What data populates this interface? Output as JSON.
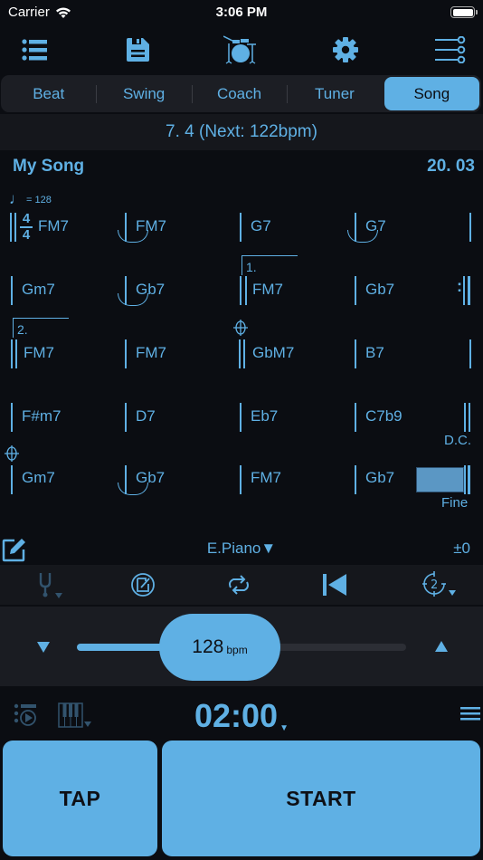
{
  "status_bar": {
    "carrier": "Carrier",
    "time": "3:06 PM",
    "wifi_icon": "wifi-icon",
    "battery_icon": "battery-icon"
  },
  "toolbar": {
    "icons": [
      "list-icon",
      "save-icon",
      "drum-kit-icon",
      "gear-icon",
      "mixer-sliders-icon"
    ]
  },
  "tabs": [
    {
      "label": "Beat",
      "active": false
    },
    {
      "label": "Swing",
      "active": false
    },
    {
      "label": "Coach",
      "active": false
    },
    {
      "label": "Tuner",
      "active": false
    },
    {
      "label": "Song",
      "active": true
    }
  ],
  "info_bar": {
    "text": "7. 4 (Next: 122bpm)"
  },
  "song": {
    "title": "My Song",
    "position": "20. 03",
    "tempo_marking": "= 128",
    "time_signature": {
      "top": "4",
      "bottom": "4"
    },
    "rows": [
      {
        "chords": [
          "FM7",
          "FM7",
          "G7",
          "G7"
        ]
      },
      {
        "chords": [
          "Gm7",
          "Gb7",
          "FM7",
          "Gb7"
        ],
        "volta": "1."
      },
      {
        "chords": [
          "FM7",
          "FM7",
          "GbM7",
          "B7"
        ],
        "volta": "2."
      },
      {
        "chords": [
          "F#m7",
          "D7",
          "Eb7",
          "C7b9"
        ]
      },
      {
        "chords": [
          "Gm7",
          "Gb7",
          "FM7",
          "Gb7"
        ]
      }
    ],
    "dc_label": "D.C.",
    "fine_label": "Fine"
  },
  "instrument_row": {
    "instrument": "E.Piano▼",
    "transpose": "±0"
  },
  "controls": {
    "icons": [
      "tuning-fork-icon",
      "auto-tempo-icon",
      "loop-icon",
      "rewind-to-start-icon",
      "count-in-icon"
    ]
  },
  "tempo": {
    "value": "128",
    "unit": "bpm",
    "slider_fraction": 0.45
  },
  "timer": {
    "value": "02:00",
    "caret": "▼"
  },
  "buttons": {
    "tap": "TAP",
    "start": "START"
  }
}
